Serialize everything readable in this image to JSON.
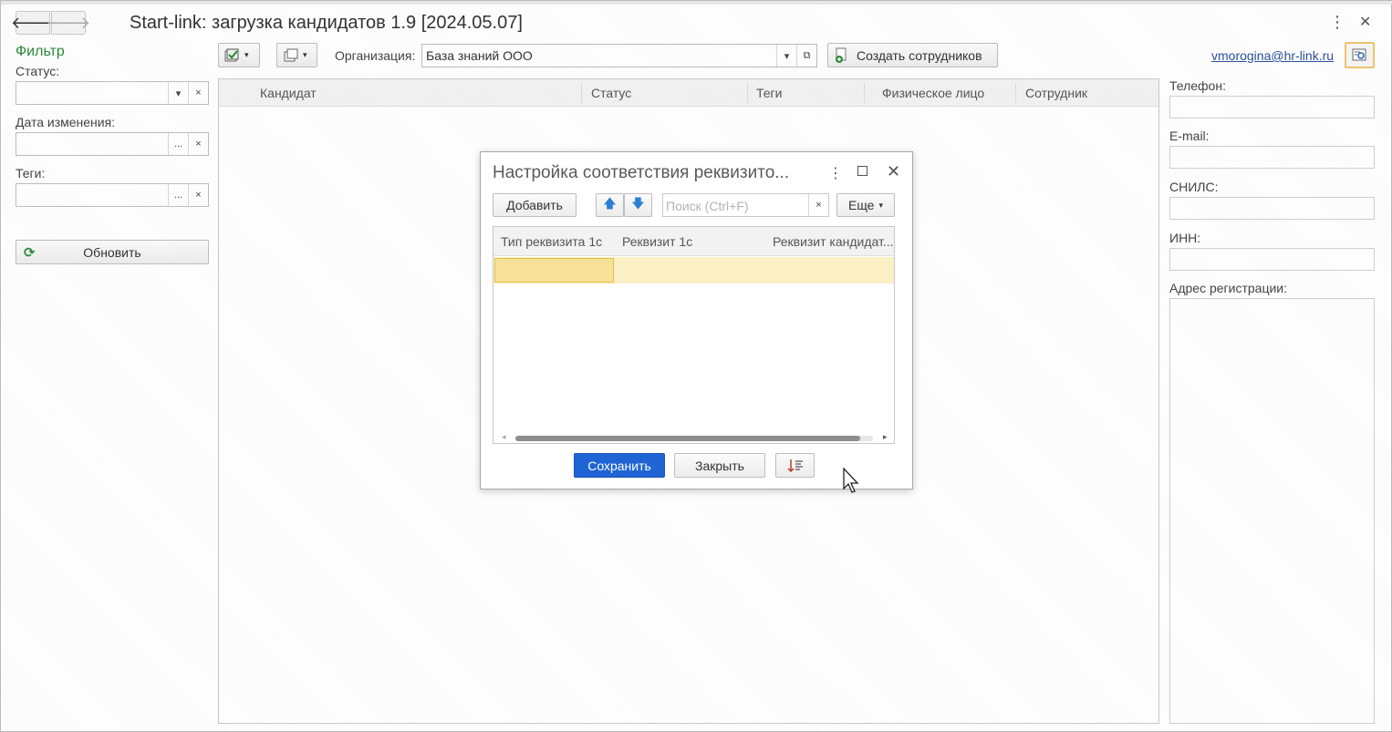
{
  "window": {
    "title": "Start-link: загрузка кандидатов 1.9 [2024.05.07]",
    "menu_glyph": "⋮",
    "close_glyph": "✕"
  },
  "nav": {
    "back_glyph": "🡐",
    "forward_glyph": "🡒"
  },
  "filter": {
    "title": "Фильтр",
    "status_label": "Статус:",
    "status_value": "",
    "date_label": "Дата изменения:",
    "date_value": "",
    "tags_label": "Теги:",
    "tags_value": "",
    "dropdown_glyph": "▾",
    "clear_glyph": "×",
    "ellipsis_glyph": "...",
    "refresh_label": "Обновить"
  },
  "toolbar": {
    "organization_label": "Организация:",
    "organization_value": "База знаний ООО",
    "create_employees_label": "Создать сотрудников",
    "user_email": "vmorogina@hr-link.ru"
  },
  "grid": {
    "columns": [
      "Кандидат",
      "Статус",
      "Теги",
      "Физическое лицо",
      "Сотрудник"
    ],
    "rows": []
  },
  "details": {
    "phone_label": "Телефон:",
    "email_label": "E-mail:",
    "snils_label": "СНИЛС:",
    "inn_label": "ИНН:",
    "address_label": "Адрес регистрации:"
  },
  "dialog": {
    "title": "Настройка соответствия реквизито...",
    "add_label": "Добавить",
    "search_placeholder": "Поиск (Ctrl+F)",
    "more_label": "Еще",
    "columns": [
      "Тип реквизита 1с",
      "Реквизит 1с",
      "Реквизит кандидат..."
    ],
    "save_label": "Сохранить",
    "close_label": "Закрыть"
  },
  "colors": {
    "accent_green": "#2a8a3a",
    "primary_blue": "#1f64d4",
    "link_blue": "#2a4fa0",
    "selected_row": "#fbefc4",
    "selected_cell": "#f7e19a"
  }
}
